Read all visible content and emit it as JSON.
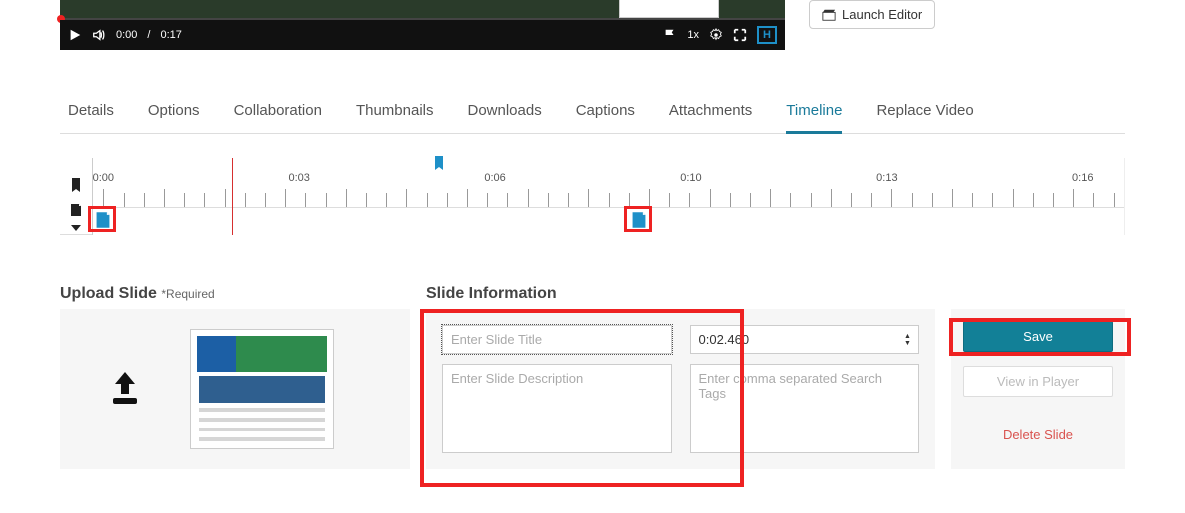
{
  "launch_editor": "Launch Editor",
  "player": {
    "current": "0:00",
    "duration": "0:17",
    "speed": "1x"
  },
  "tabs": [
    "Details",
    "Options",
    "Collaboration",
    "Thumbnails",
    "Downloads",
    "Captions",
    "Attachments",
    "Timeline",
    "Replace Video"
  ],
  "active_tab": "Timeline",
  "timeline": {
    "labels": [
      "0:00",
      "0:03",
      "0:06",
      "0:10",
      "0:13",
      "0:16"
    ],
    "label_positions_pct": [
      1,
      20,
      39,
      58,
      77,
      96
    ],
    "bookmark_pct": 33,
    "playhead_pct": 13.5,
    "slide_markers_pct": [
      1,
      53
    ]
  },
  "upload": {
    "title": "Upload Slide",
    "required": "*Required"
  },
  "info": {
    "title": "Slide Information",
    "title_placeholder": "Enter Slide Title",
    "desc_placeholder": "Enter Slide Description",
    "time_value": "0:02.460",
    "tags_placeholder": "Enter comma separated Search Tags"
  },
  "side": {
    "save": "Save",
    "view": "View in Player",
    "delete": "Delete Slide"
  }
}
